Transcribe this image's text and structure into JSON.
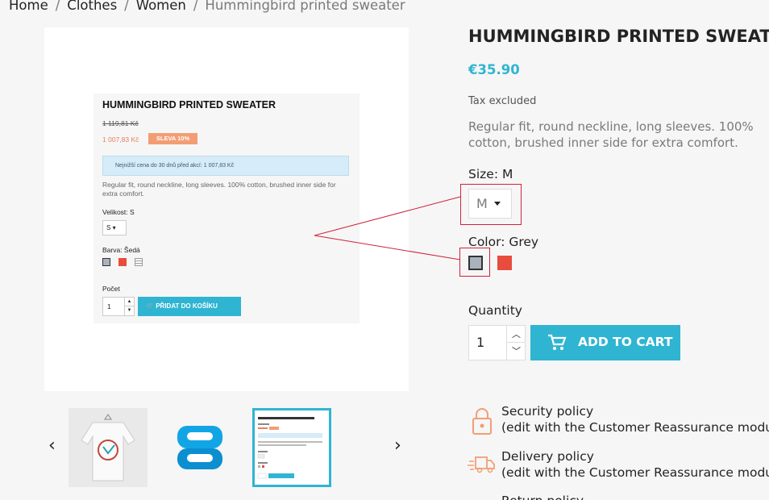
{
  "breadcrumb": [
    "Home",
    "Clothes",
    "Women",
    "Hummingbird printed sweater"
  ],
  "product": {
    "title": "HUMMINGBIRD PRINTED SWEATER",
    "price": "€35.90",
    "tax_note": "Tax excluded",
    "description": "Regular fit, round neckline, long sleeves. 100% cotton, brushed inner side for extra comfort.",
    "size_label": "Size: M",
    "size_value": "M",
    "color_label": "Color: Grey",
    "colors": [
      "#aab2bd",
      "#e84c3d"
    ],
    "quantity_label": "Quantity",
    "quantity_value": "1",
    "add_to_cart": "ADD TO CART"
  },
  "inner_image": {
    "title": "HUMMINGBIRD PRINTED SWEATER",
    "old_price": "1 119,81 Kč",
    "new_price": "1 007,83 Kč",
    "discount": "SLEVA 10%",
    "lowest_price_note": "Nejnižší cena do 30 dnů před akcí: 1 007,83 Kč",
    "description": "Regular fit, round neckline, long sleeves. 100% cotton, brushed inner side for extra comfort.",
    "size_label": "Velikost: S",
    "size_value": "S",
    "color_label": "Barva: Šedá",
    "quantity_label": "Počet",
    "quantity_value": "1",
    "add_to_cart": "PŘIDAT DO KOŠÍKU"
  },
  "reassurance": [
    {
      "title": "Security policy",
      "subtitle": "(edit with the Customer Reassurance module)"
    },
    {
      "title": "Delivery policy",
      "subtitle": "(edit with the Customer Reassurance module)"
    },
    {
      "title": "Return policy",
      "subtitle": ""
    }
  ],
  "colors": {
    "accent": "#2fb5d2",
    "highlight": "#d0233a"
  }
}
